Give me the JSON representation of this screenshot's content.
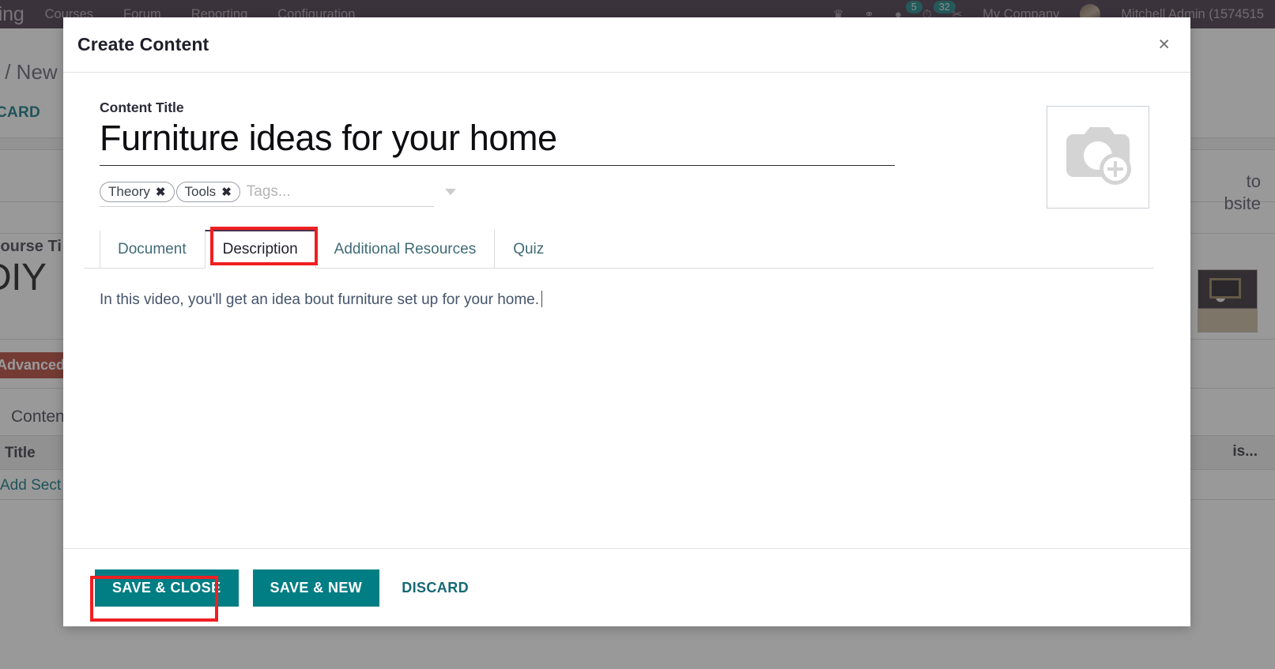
{
  "app": {
    "navbar": {
      "brand": "rning",
      "menu": [
        "Courses",
        "Forum",
        "Reporting",
        "Configuration"
      ],
      "icons": [
        "crown-icon",
        "bug-icon",
        "messages-icon",
        "activities-icon",
        "scissors-icon"
      ],
      "badges": {
        "messages": "5",
        "activities": "32"
      },
      "company": "My Company",
      "user": "Mitchell Admin (1574515",
      "bg_color": "#3b2b3e",
      "badge_color": "#0d7b7d"
    },
    "background": {
      "breadcrumb": "s / New",
      "discard": "SCARD",
      "course_label": "Course Ti",
      "course_title": "DIY",
      "difficulty_badge": "Advanced",
      "difficulty_color": "#b23b2e",
      "content_label": "Content",
      "title_column": "Title",
      "add_section": "Add Sect",
      "go_to_website_line1": "to",
      "go_to_website_line2": "bsite",
      "right_truncated_text": "is..."
    }
  },
  "modal": {
    "title": "Create Content",
    "close_label": "×",
    "content_title": {
      "label": "Content Title",
      "value": "Furniture ideas for your home"
    },
    "tags": {
      "chips": [
        {
          "label": "Theory",
          "remove": "✖"
        },
        {
          "label": "Tools",
          "remove": "✖"
        }
      ],
      "placeholder": "Tags...",
      "value": ""
    },
    "image_placeholder": {
      "icon": "camera-add-icon"
    },
    "tabs": [
      {
        "label": "Document",
        "active": false
      },
      {
        "label": "Description",
        "active": true
      },
      {
        "label": "Additional Resources",
        "active": false
      },
      {
        "label": "Quiz",
        "active": false
      }
    ],
    "description": {
      "text": "In this video, you'll get an idea bout furniture set up for your home."
    },
    "footer": {
      "save_close": "SAVE & CLOSE",
      "save_new": "SAVE & NEW",
      "discard": "DISCARD",
      "primary_color": "#017e84"
    },
    "highlights": {
      "color": "#ef1f22",
      "targets": [
        "tab-description",
        "save-and-close-button"
      ]
    }
  }
}
